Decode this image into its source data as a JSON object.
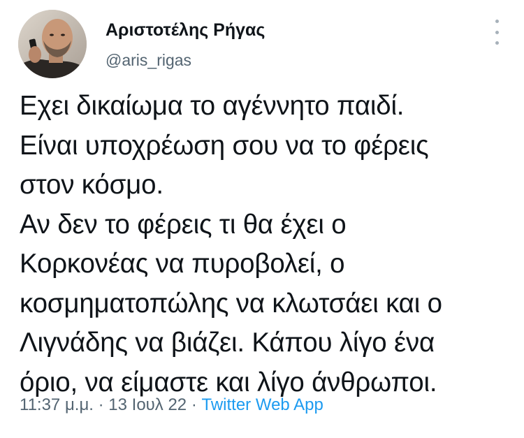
{
  "tweet": {
    "author_name": "Αριστοτέλης Ρήγας",
    "handle": "@aris_rigas",
    "text_lines": [
      "Εχει δικαίωμα το αγέννητο παιδί.",
      "Είναι υποχρέωση σου να το φέρεις",
      "στον κόσμο.",
      "Αν δεν το φέρεις τι θα έχει ο",
      "Κορκονέας να πυροβολεί, ο",
      "κοσμηματοπώλης να κλωτσάει και ο",
      "Λιγνάδης να βιάζει. Κάπου λίγο ένα",
      "όριο, να είμαστε και λίγο άνθρωποι."
    ],
    "time": "11:37 μ.μ.",
    "separator": "·",
    "date": "13 Ιουλ 22",
    "source": "Twitter Web App"
  },
  "icons": {
    "more": "more-vertical-icon",
    "avatar": "profile-photo"
  },
  "colors": {
    "text": "#0f1419",
    "secondary": "#536471",
    "link": "#1d9bf0",
    "background": "#ffffff"
  }
}
